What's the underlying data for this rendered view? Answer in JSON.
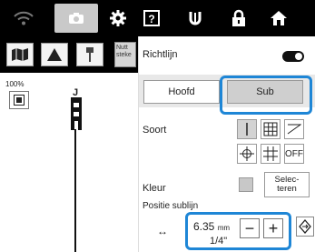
{
  "left": {
    "label_box": "Nutt steke",
    "zoom": "100%",
    "figure_label": "J"
  },
  "panel": {
    "richtlijn": "Richtlijn",
    "toggle_on": true,
    "tabs": [
      {
        "label": "Hoofd",
        "selected": false
      },
      {
        "label": "Sub",
        "selected": true
      }
    ],
    "soort": "Soort",
    "off": "OFF",
    "kleur": "Kleur",
    "select_line1": "Selec-",
    "select_line2": "teren",
    "positie": "Positie sublijn",
    "pos_value": "6.35",
    "pos_unit": "mm",
    "pos_inch": "1/4\"",
    "minus": "−",
    "plus": "+"
  },
  "colors": {
    "highlight": "#1e86d6",
    "topbar": "#000000",
    "selected_tab": "#cfcfcf"
  }
}
